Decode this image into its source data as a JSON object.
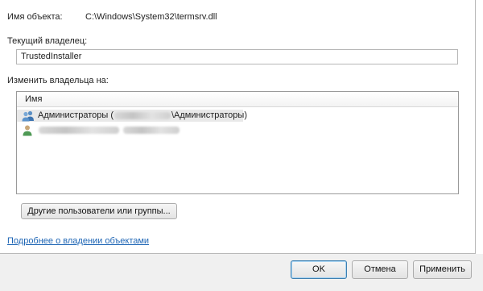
{
  "object": {
    "name_label": "Имя объекта:",
    "name_value": "C:\\Windows\\System32\\termsrv.dll"
  },
  "owner": {
    "current_label": "Текущий владелец:",
    "current_value": "TrustedInstaller",
    "change_label": "Изменить владельца на:"
  },
  "list": {
    "header": "Имя",
    "items": [
      {
        "prefix": "Администраторы (",
        "suffix": "\\Администраторы)",
        "icon": "user-group-icon",
        "selected": true
      },
      {
        "prefix": "",
        "suffix": "",
        "icon": "user-icon",
        "selected": false
      }
    ]
  },
  "buttons": {
    "other_users": "Другие пользователи или группы...",
    "ok": "OK",
    "cancel": "Отмена",
    "apply": "Применить"
  },
  "link": {
    "more_info": "Подробнее о владении объектами"
  },
  "colors": {
    "link": "#1c64b4",
    "selected_row": "#e9e9e9",
    "bottom_bar": "#f0f0f0"
  }
}
